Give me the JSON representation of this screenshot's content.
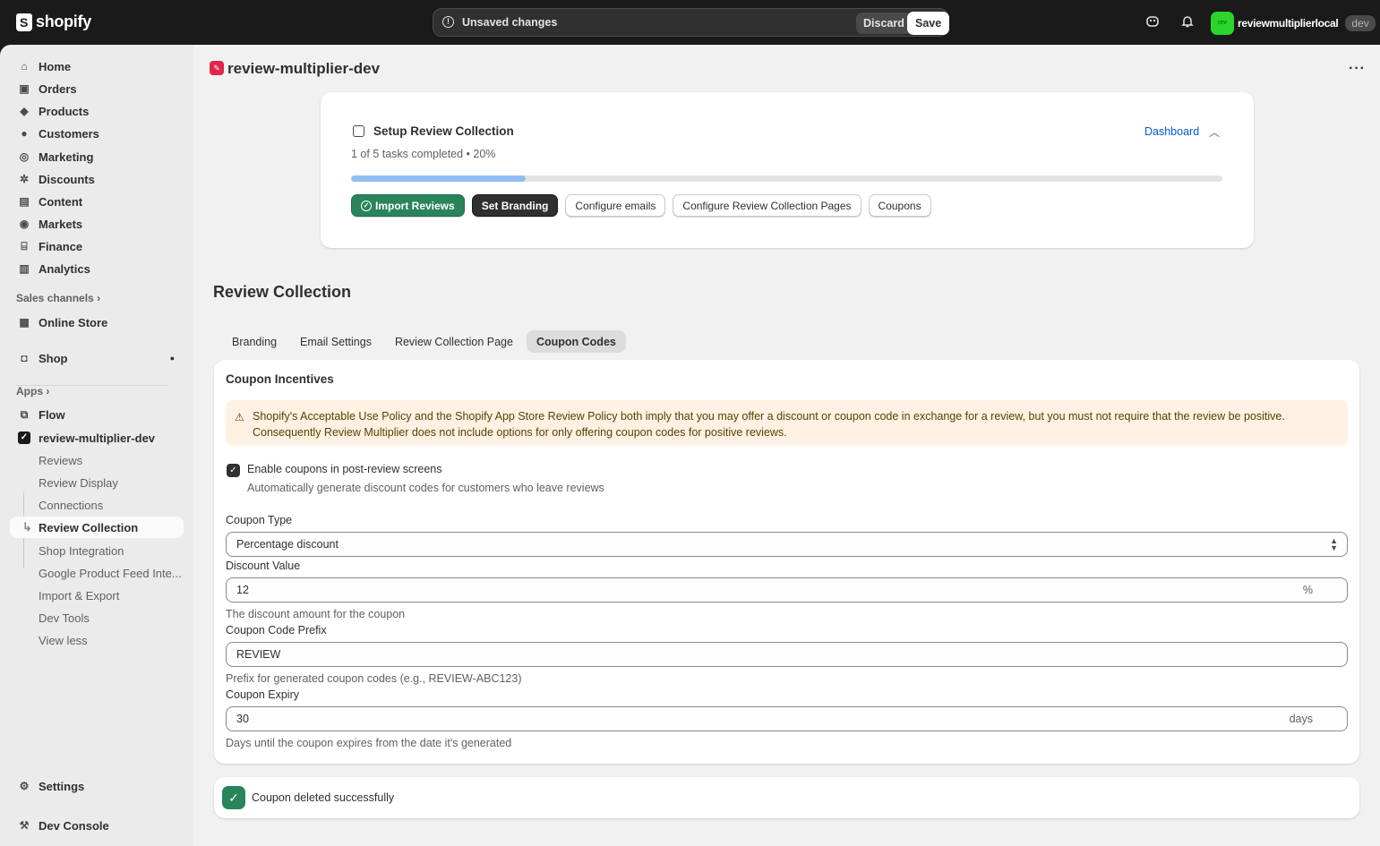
{
  "topbar": {
    "brand": "shopify",
    "unsaved_text": "Unsaved changes",
    "discard_label": "Discard",
    "save_label": "Save",
    "avatar_text": "rev",
    "store_name": "reviewmultiplierlocal",
    "env_tag": "dev"
  },
  "sidebar": {
    "main_items": [
      {
        "label": "Home",
        "icon": "home-icon"
      },
      {
        "label": "Orders",
        "icon": "orders-icon"
      },
      {
        "label": "Products",
        "icon": "tag-icon"
      },
      {
        "label": "Customers",
        "icon": "person-icon"
      },
      {
        "label": "Marketing",
        "icon": "target-icon"
      },
      {
        "label": "Discounts",
        "icon": "discount-icon"
      },
      {
        "label": "Content",
        "icon": "content-icon"
      },
      {
        "label": "Markets",
        "icon": "globe-icon"
      },
      {
        "label": "Finance",
        "icon": "bank-icon"
      },
      {
        "label": "Analytics",
        "icon": "chart-icon"
      }
    ],
    "sales_channels_label": "Sales channels",
    "online_store": "Online Store",
    "shop": "Shop",
    "apps_label": "Apps",
    "flow": "Flow",
    "app_name": "review-multiplier-dev",
    "app_sub_items": [
      "Reviews",
      "Review Display",
      "Connections",
      "Review Collection",
      "Shop Integration",
      "Google Product Feed Inte...",
      "Import & Export",
      "Dev Tools",
      "View less"
    ],
    "settings": "Settings",
    "dev_console": "Dev Console"
  },
  "header": {
    "app_title": "review-multiplier-dev"
  },
  "setup": {
    "title": "Setup Review Collection",
    "subtitle": "1 of 5 tasks completed • 20%",
    "dashboard_link": "Dashboard",
    "progress": 0.2,
    "tasks": [
      "Import Reviews",
      "Set Branding",
      "Configure emails",
      "Configure Review Collection Pages",
      "Coupons"
    ]
  },
  "review_collection": {
    "title": "Review Collection",
    "tabs": [
      "Branding",
      "Email Settings",
      "Review Collection Page",
      "Coupon Codes"
    ],
    "active_tab": "Coupon Codes"
  },
  "coupon": {
    "title": "Coupon Incentives",
    "banner": "Shopify's Acceptable Use Policy and the Shopify App Store Review Policy both imply that you may offer a discount or coupon code in exchange for a review, but you must not require that the review be positive. Consequently Review Multiplier does not include options for only offering coupon codes for positive reviews.",
    "enable_label": "Enable coupons in post-review screens",
    "enable_help": "Automatically generate discount codes for customers who leave reviews",
    "type_label": "Coupon Type",
    "type_value": "Percentage discount",
    "value_label": "Discount Value",
    "value_value": "12",
    "value_suffix": "%",
    "value_help": "The discount amount for the coupon",
    "prefix_label": "Coupon Code Prefix",
    "prefix_value": "REVIEW",
    "prefix_help": "Prefix for generated coupon codes (e.g., REVIEW-ABC123)",
    "expiry_label": "Coupon Expiry",
    "expiry_value": "30",
    "expiry_suffix": "days",
    "expiry_help": "Days until the coupon expires from the date it's generated"
  },
  "toast": {
    "message": "Coupon deleted successfully"
  }
}
